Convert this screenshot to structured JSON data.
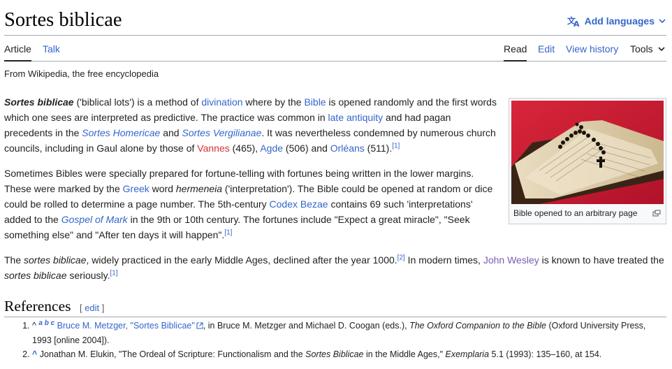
{
  "header": {
    "title": "Sortes biblicae",
    "add_languages": "Add languages"
  },
  "tabs": {
    "article": "Article",
    "talk": "Talk",
    "read": "Read",
    "edit": "Edit",
    "view_history": "View history",
    "tools": "Tools"
  },
  "tagline": "From Wikipedia, the free encyclopedia",
  "figure": {
    "caption": "Bible opened to an arbitrary page"
  },
  "para1": {
    "term": "Sortes biblicae",
    "t1": " ('biblical lots') is a method of ",
    "l_divination": "divination",
    "t2": " where by the ",
    "l_bible": "Bible",
    "t3": " is opened randomly and the first words which one sees are interpreted as predictive. The practice was common in ",
    "l_late_antiquity": "late antiquity",
    "t4": " and had pagan precedents in the ",
    "l_sortes_homericae": "Sortes Homericae",
    "t5": " and ",
    "l_sortes_vergilianae": "Sortes Vergilianae",
    "t6": ". It was nevertheless condemned by numerous church councils, including in Gaul alone by those of ",
    "l_vannes": "Vannes",
    "t7": " (465), ",
    "l_agde": "Agde",
    "t8": " (506) and ",
    "l_orleans": "Orléans",
    "t9": " (511).",
    "ref1": "[1]"
  },
  "para2": {
    "t1": "Sometimes Bibles were specially prepared for fortune-telling with fortunes being written in the lower margins. These were marked by the ",
    "l_greek": "Greek",
    "t2": " word ",
    "term": "hermeneia",
    "t3": " ('interpretation'). The Bible could be opened at random or dice could be rolled to determine a page number. The 5th-century ",
    "l_codex_bezae": "Codex Bezae",
    "t4": " contains 69 such 'interpretations' added to the ",
    "l_gospel_of_mark": "Gospel of Mark",
    "t5": " in the 9th or 10th century. The fortunes include \"Expect a great miracle\", \"Seek something else\" and \"After ten days it will happen\".",
    "ref1": "[1]"
  },
  "para3": {
    "t1": "The ",
    "term1": "sortes biblicae",
    "t2": ", widely practiced in the early Middle Ages, declined after the year 1000.",
    "ref2": "[2]",
    "t3": " In modern times, ",
    "l_john_wesley": "John Wesley",
    "t4": " is known to have treated the ",
    "term2": "sortes biblicae",
    "t5": " seriously.",
    "ref1": "[1]"
  },
  "references": {
    "heading": "References",
    "edit_label": "edit",
    "edit_open": "[ ",
    "edit_close": " ]",
    "items": [
      {
        "caret": "^",
        "backrefs": "a b c",
        "link": "Bruce M. Metzger, \"Sortes Biblicae\"",
        "t1": ", in Bruce M. Metzger and Michael D. Coogan (eds.), ",
        "work": "The Oxford Companion to the Bible",
        "t2": " (Oxford University Press, 1993 [online 2004])."
      },
      {
        "caret": "^",
        "t1": "Jonathan M. Elukin, \"The Ordeal of Scripture: Functionalism and the ",
        "term": "Sortes Biblicae",
        "t2": " in the Middle Ages,\" ",
        "journal": "Exemplaria",
        "t3": " 5.1 (1993): 135–160, at 154."
      }
    ]
  },
  "colors": {
    "link": "#3366cc",
    "redlink": "#d73333",
    "visited": "#795cb2",
    "text": "#202122"
  }
}
